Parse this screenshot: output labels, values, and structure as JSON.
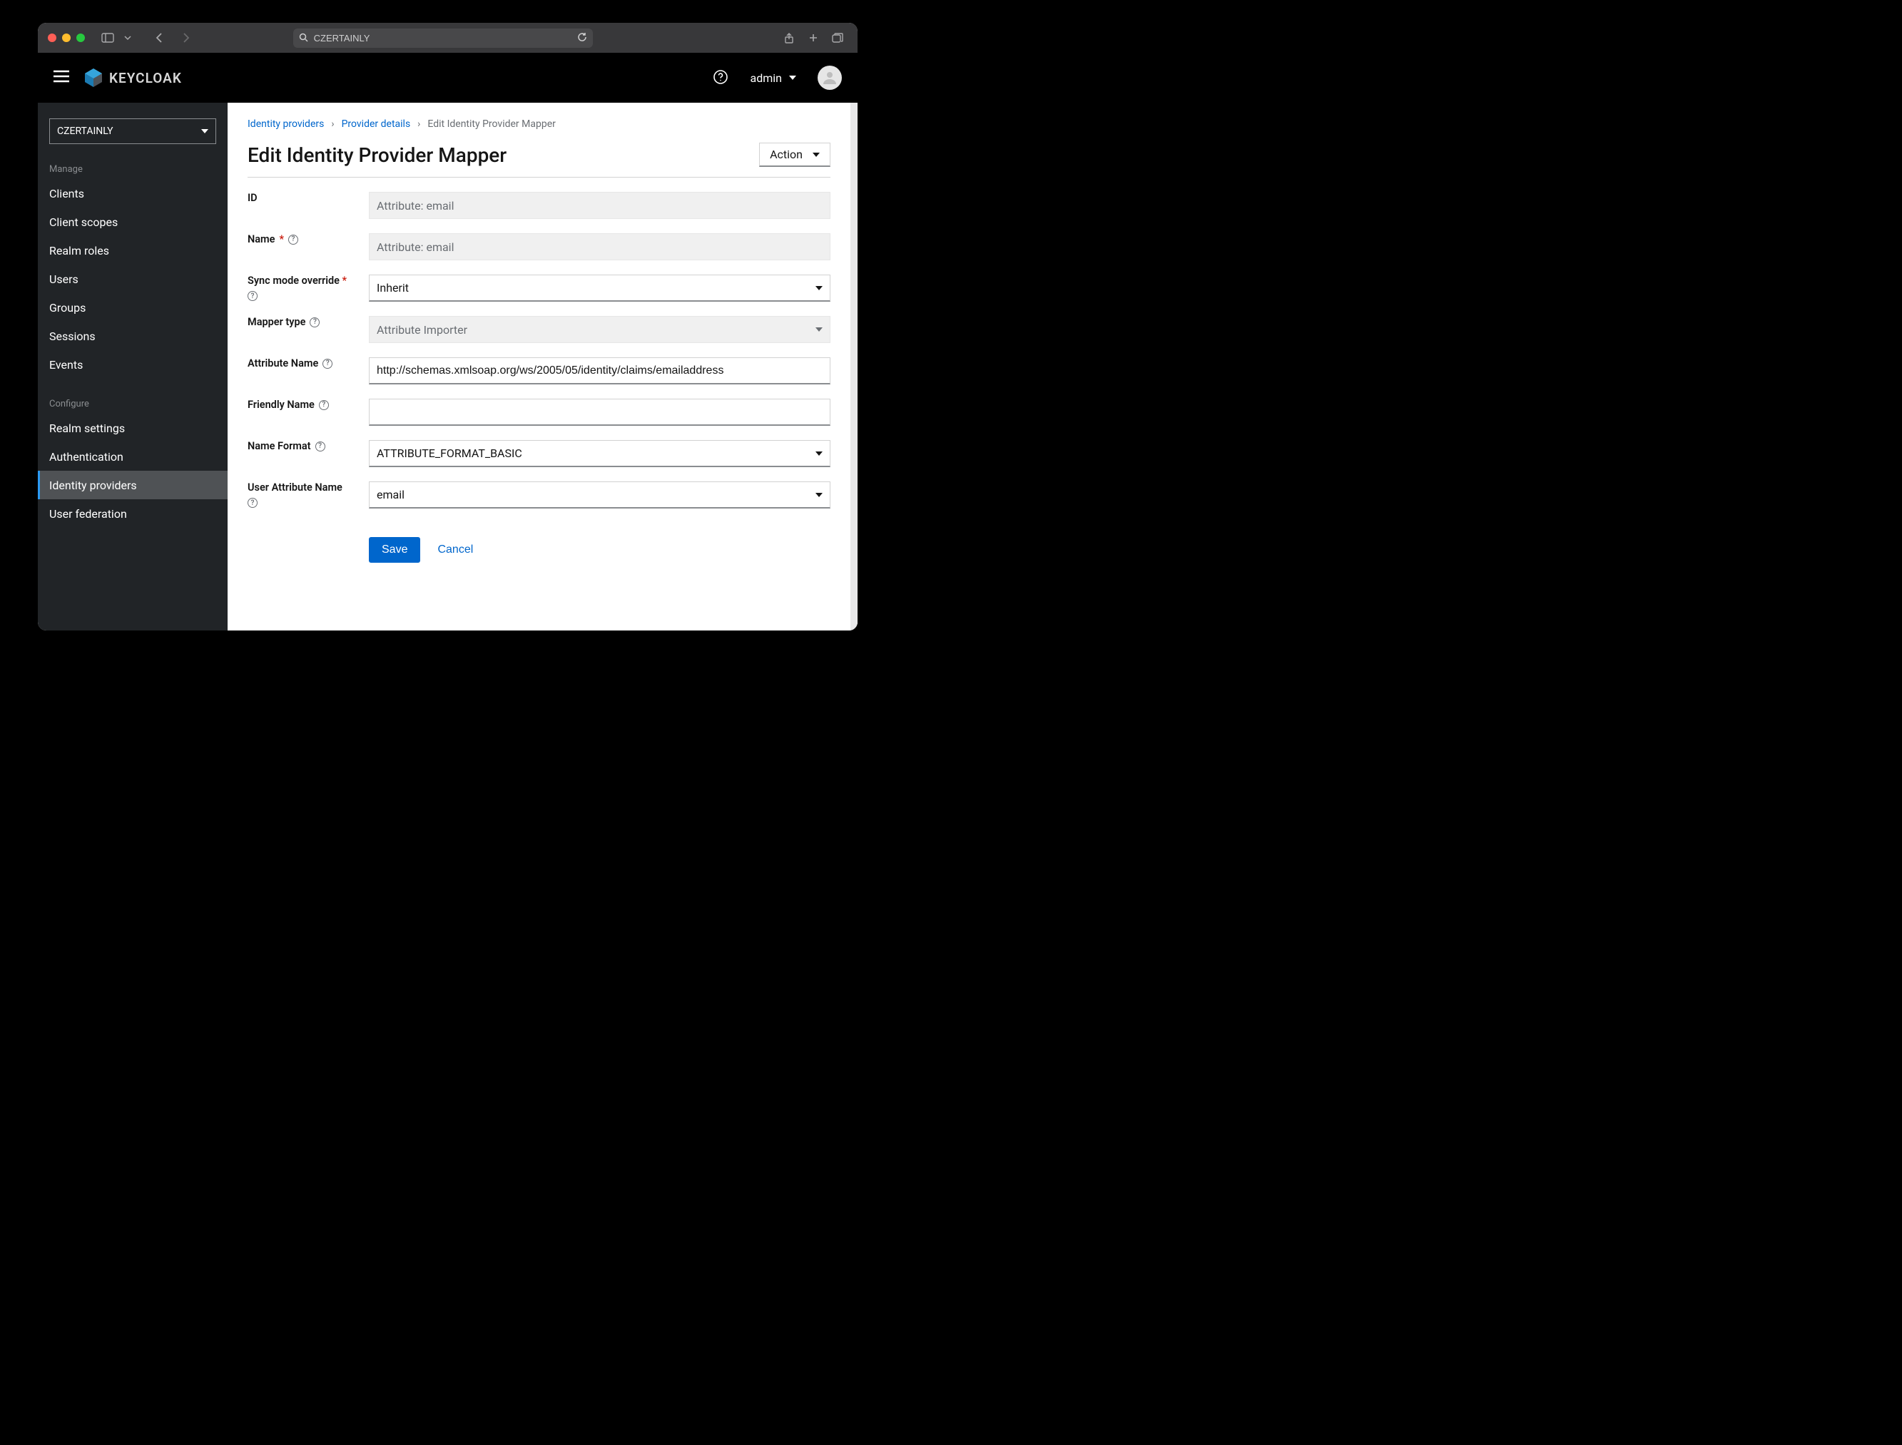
{
  "browser": {
    "address": "CZERTAINLY"
  },
  "header": {
    "brand_text": "KEYCLOAK",
    "user": "admin"
  },
  "sidebar": {
    "realm": "CZERTAINLY",
    "section_manage": "Manage",
    "section_configure": "Configure",
    "manage_items": [
      {
        "label": "Clients"
      },
      {
        "label": "Client scopes"
      },
      {
        "label": "Realm roles"
      },
      {
        "label": "Users"
      },
      {
        "label": "Groups"
      },
      {
        "label": "Sessions"
      },
      {
        "label": "Events"
      }
    ],
    "configure_items": [
      {
        "label": "Realm settings"
      },
      {
        "label": "Authentication"
      },
      {
        "label": "Identity providers"
      },
      {
        "label": "User federation"
      }
    ]
  },
  "breadcrumb": {
    "identity_providers": "Identity providers",
    "provider_details": "Provider details",
    "current": "Edit Identity Provider Mapper"
  },
  "page": {
    "title": "Edit Identity Provider Mapper",
    "action_label": "Action"
  },
  "form": {
    "labels": {
      "id": "ID",
      "name": "Name",
      "sync_mode": "Sync mode override",
      "mapper_type": "Mapper type",
      "attribute_name": "Attribute Name",
      "friendly_name": "Friendly Name",
      "name_format": "Name Format",
      "user_attribute_name": "User Attribute Name"
    },
    "values": {
      "id": "Attribute: email",
      "name": "Attribute: email",
      "sync_mode": "Inherit",
      "mapper_type": "Attribute Importer",
      "attribute_name": "http://schemas.xmlsoap.org/ws/2005/05/identity/claims/emailaddress",
      "friendly_name": "",
      "name_format": "ATTRIBUTE_FORMAT_BASIC",
      "user_attribute_name": "email"
    },
    "buttons": {
      "save": "Save",
      "cancel": "Cancel"
    }
  }
}
